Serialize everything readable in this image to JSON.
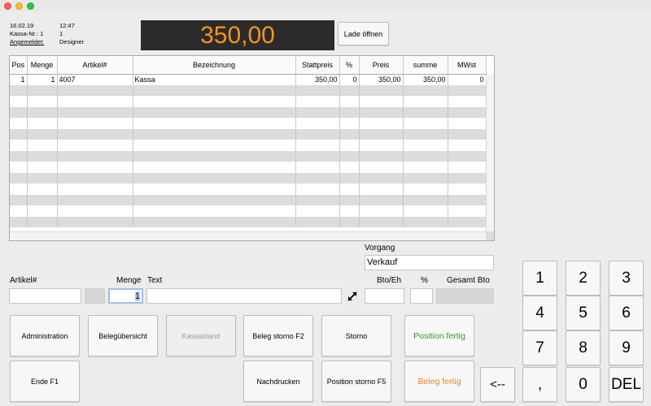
{
  "info": {
    "date": "16.02.19",
    "time": "12:47",
    "register_label": "Kassa-Nr.: 1",
    "register_value": "1",
    "logged_in_label": "Angemeldet:",
    "logged_in_value": "Designer"
  },
  "display": {
    "amount": "350,00"
  },
  "buttons": {
    "open_drawer": "Lade öffnen",
    "administration": "Administration",
    "receipt_overview": "Belegübersicht",
    "cash_status": "Kassastand",
    "cancel_receipt": "Beleg storno F2",
    "cancel": "Storno",
    "position_done": "Position fertig",
    "exit": "Ende F1",
    "reprint": "Nachdrucken",
    "cancel_position": "Position storno F5",
    "receipt_done": "Beleg fertig",
    "backspace": "<--"
  },
  "table": {
    "columns": [
      "Pos",
      "Menge",
      "Artikel#",
      "Bezeichnung",
      "Stattpreis",
      "%",
      "Preis",
      "summe",
      "MWst"
    ],
    "rows": [
      [
        "1",
        "1",
        "4007",
        "Kassa",
        "350,00",
        "0",
        "350,00",
        "350,00",
        "0"
      ]
    ]
  },
  "transaction": {
    "label": "Vorgang",
    "value": "Verkauf"
  },
  "entry": {
    "article_label": "Artikel#",
    "quantity_label": "Menge",
    "text_label": "Text",
    "quantity_value": "1",
    "gross_unit_label": "Bto/Eh",
    "percent_label": "%",
    "total_gross_label": "Gesamt Bto"
  },
  "keypad": [
    "1",
    "2",
    "3",
    "4",
    "5",
    "6",
    "7",
    "8",
    "9",
    ",",
    "0",
    "DEL"
  ],
  "colors": {
    "display_bg": "#2b2b2b",
    "display_text": "#f7941d",
    "position_done": "#2e9c2e",
    "receipt_done": "#f08020"
  }
}
